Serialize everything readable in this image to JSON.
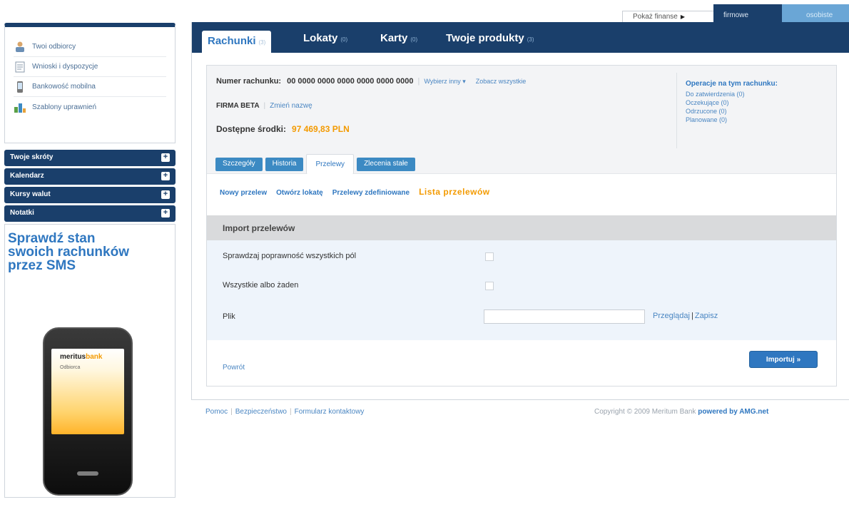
{
  "topbar": {
    "show_finance": "Pokaż finanse",
    "tab_firm": "firmowe",
    "tab_private": "osobiste"
  },
  "sidebar": {
    "links": [
      {
        "label": "Twoi odbiorcy",
        "icon": "recipients-icon"
      },
      {
        "label": "Wnioski i dyspozycje",
        "icon": "document-icon"
      },
      {
        "label": "Bankowość mobilna",
        "icon": "mobile-icon"
      },
      {
        "label": "Szablony uprawnień",
        "icon": "permissions-icon"
      }
    ],
    "sections": [
      {
        "label": "Twoje skróty"
      },
      {
        "label": "Kalendarz"
      },
      {
        "label": "Kursy walut"
      },
      {
        "label": "Notatki"
      }
    ],
    "ad": {
      "headline_1": "Sprawdź stan",
      "headline_2": "swoich rachunków",
      "headline_3": "przez SMS",
      "phone_brand_a": "meritus",
      "phone_brand_b": "bank",
      "phone_sub": "Odbiorca"
    }
  },
  "main": {
    "tabs": [
      {
        "label": "Rachunki",
        "count": "(3)"
      },
      {
        "label": "Lokaty",
        "count": "(0)"
      },
      {
        "label": "Karty",
        "count": "(0)"
      },
      {
        "label": "Twoje produkty",
        "count": "(3)"
      }
    ],
    "account": {
      "number_label": "Numer rachunku:",
      "number": "00 0000 0000 0000 0000 0000 0000",
      "choose_other": "Wybierz inny ▾",
      "show_all": "Zobacz wszystkie",
      "firm_name": "FIRMA BETA",
      "rename": "Zmień nazwę",
      "available_label": "Dostępne środki:",
      "available_value": "97 469,83 PLN"
    },
    "operations": {
      "title": "Operacje na tym rachunku:",
      "items": [
        "Do zatwierdzenia (0)",
        "Oczekujące (0)",
        "Odrzucone (0)",
        "Planowane (0)"
      ]
    },
    "subtabs": [
      "Szczegóły",
      "Historia",
      "Przelewy",
      "Zlecenia stałe"
    ],
    "actions": {
      "new_transfer": "Nowy przelew",
      "open_deposit": "Otwórz lokatę",
      "defined_transfers": "Przelewy zdefiniowane",
      "transfer_list": "Lista przelewów"
    },
    "import": {
      "title": "Import przelewów",
      "validate_label": "Sprawdzaj poprawność wszystkich pól",
      "all_or_none_label": "Wszystkie albo żaden",
      "file_label": "Plik",
      "browse": "Przeglądaj",
      "save": "Zapisz",
      "back": "Powrót",
      "import_button": "Importuj »"
    }
  },
  "footer": {
    "help": "Pomoc",
    "security": "Bezpieczeństwo",
    "contact_form": "Formularz kontaktowy",
    "copyright": "Copyright © 2009 Meritum Bank",
    "powered_by": "powered by AMG.net"
  },
  "colors": {
    "navy": "#1a3f6b",
    "blue": "#2f77c0",
    "light_blue": "#6aa6d6",
    "orange": "#f39a00"
  }
}
